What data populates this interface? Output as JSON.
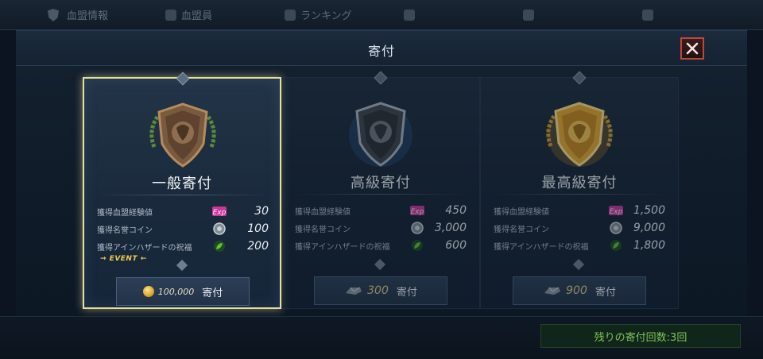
{
  "background": {
    "tabs": [
      {
        "label": "血盟情報"
      },
      {
        "label": "血盟員"
      },
      {
        "label": "ランキング"
      },
      {
        "label": ""
      },
      {
        "label": ""
      },
      {
        "label": ""
      }
    ],
    "remaining_label": "残りの寄付回数:3回"
  },
  "modal": {
    "title": "寄付",
    "close_icon": "close-icon"
  },
  "cards": [
    {
      "title": "一般寄付",
      "tier": "bronze",
      "selected": true,
      "rows": [
        {
          "label": "獲得血盟経験値",
          "icon": "exp-icon",
          "value": "30"
        },
        {
          "label": "獲得名誉コイン",
          "icon": "honor-coin-icon",
          "value": "100"
        },
        {
          "label": "獲得アインハザードの祝福",
          "icon": "blessing-leaf-icon",
          "value": "200"
        }
      ],
      "event_tag": "→ EVENT ←",
      "cost": "100,000",
      "cost_icon": "gold-coin-icon",
      "button_label": "寄付"
    },
    {
      "title": "高級寄付",
      "tier": "silver",
      "selected": false,
      "rows": [
        {
          "label": "獲得血盟経験値",
          "icon": "exp-icon",
          "value": "450"
        },
        {
          "label": "獲得名誉コイン",
          "icon": "honor-coin-icon",
          "value": "3,000"
        },
        {
          "label": "獲得アインハザードの祝福",
          "icon": "blessing-leaf-icon",
          "value": "600"
        }
      ],
      "event_tag": "",
      "cost": "300",
      "cost_icon": "crystal-icon",
      "button_label": "寄付"
    },
    {
      "title": "最高級寄付",
      "tier": "gold",
      "selected": false,
      "rows": [
        {
          "label": "獲得血盟経験値",
          "icon": "exp-icon",
          "value": "1,500"
        },
        {
          "label": "獲得名誉コイン",
          "icon": "honor-coin-icon",
          "value": "9,000"
        },
        {
          "label": "獲得アインハザードの祝福",
          "icon": "blessing-leaf-icon",
          "value": "1,800"
        }
      ],
      "event_tag": "",
      "cost": "900",
      "cost_icon": "crystal-icon",
      "button_label": "寄付"
    }
  ],
  "colors": {
    "bronze": "#8a6a4a",
    "silver": "#4a4e55",
    "gold": "#e0a62a",
    "selected_border": "#e7dfa0",
    "event": "#f3c94a",
    "remaining_text": "#7fc25a"
  }
}
